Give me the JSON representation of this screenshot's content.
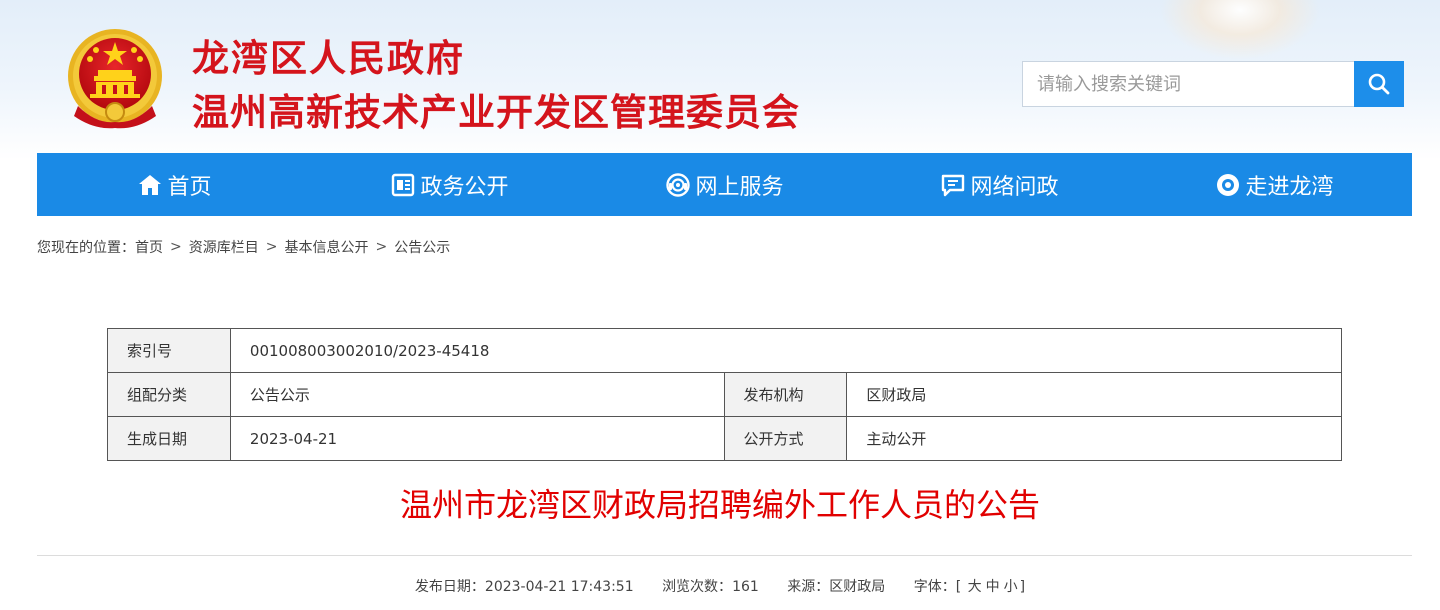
{
  "header": {
    "title_line1": "龙湾区人民政府",
    "title_line2": "温州高新技术产业开发区管理委员会"
  },
  "search": {
    "placeholder": "请输入搜索关键词",
    "button_icon": "search-icon"
  },
  "nav": {
    "items": [
      {
        "label": "首页",
        "icon": "home-icon"
      },
      {
        "label": "政务公开",
        "icon": "document-icon"
      },
      {
        "label": "网上服务",
        "icon": "service-icon"
      },
      {
        "label": "网络问政",
        "icon": "message-icon"
      },
      {
        "label": "走进龙湾",
        "icon": "eye-icon"
      }
    ]
  },
  "breadcrumb": {
    "prefix": "您现在的位置：",
    "items": [
      "首页",
      "资源库栏目",
      "基本信息公开",
      "公告公示"
    ],
    "separator": ">"
  },
  "info": {
    "index_label": "索引号",
    "index_value": "001008003002010/2023-45418",
    "category_label": "组配分类",
    "category_value": "公告公示",
    "publisher_label": "发布机构",
    "publisher_value": "区财政局",
    "date_label": "生成日期",
    "date_value": "2023-04-21",
    "mode_label": "公开方式",
    "mode_value": "主动公开"
  },
  "article": {
    "title": "温州市龙湾区财政局招聘编外工作人员的公告"
  },
  "meta": {
    "publish_label": "发布日期：",
    "publish_value": "2023-04-21 17:43:51",
    "views_label": "浏览次数：",
    "views_value": "161",
    "source_label": "来源：",
    "source_value": "区财政局",
    "font_label": "字体：",
    "bracket_open": "[",
    "size_large": "大",
    "size_medium": "中",
    "size_small": "小",
    "bracket_close": "]"
  },
  "colors": {
    "brand_red": "#d4141c",
    "nav_blue": "#1a8ae6",
    "title_red": "#e10000"
  }
}
